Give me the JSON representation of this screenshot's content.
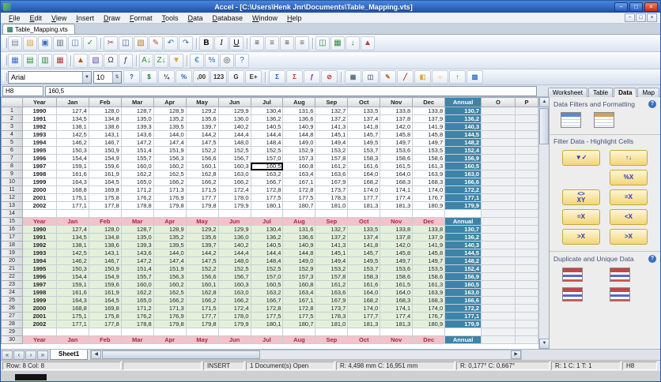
{
  "window": {
    "title": "Accel - [C:\\Users\\Henk Jnr\\Documents\\Table_Mapping.vts]",
    "doc_tab": "Table_Mapping.vts",
    "controls": [
      {
        "name": "minimize-button",
        "glyph": "−"
      },
      {
        "name": "maximize-button",
        "glyph": "□"
      },
      {
        "name": "close-button",
        "glyph": "×"
      }
    ]
  },
  "menu": {
    "items": [
      "File",
      "Edit",
      "View",
      "Insert",
      "Draw",
      "Format",
      "Tools",
      "Data",
      "Database",
      "Window",
      "Help"
    ],
    "window_controls": [
      {
        "name": "child-minimize-button",
        "glyph": "−"
      },
      {
        "name": "child-restore-button",
        "glyph": "□"
      },
      {
        "name": "child-close-button",
        "glyph": "×"
      }
    ]
  },
  "toolbar_main": {
    "icons": [
      {
        "name": "new-document",
        "glyph": "▤",
        "color": "#7a8aa0"
      },
      {
        "name": "open-folder",
        "glyph": "▨",
        "color": "#d9a62e"
      },
      {
        "name": "save",
        "glyph": "▣",
        "color": "#3a6fc0"
      },
      {
        "name": "print",
        "glyph": "▥",
        "color": "#5a6a7a"
      },
      {
        "name": "print-preview",
        "glyph": "◫",
        "color": "#4a7ab0"
      },
      {
        "name": "spellcheck",
        "glyph": "✓",
        "color": "#2e8b2e"
      },
      {
        "sep": true
      },
      {
        "name": "cut",
        "glyph": "✂",
        "color": "#9a3a3a"
      },
      {
        "name": "copy",
        "glyph": "◫",
        "color": "#3a5a9a"
      },
      {
        "name": "paste",
        "glyph": "▧",
        "color": "#b07a2a"
      },
      {
        "name": "format-painter",
        "glyph": "✎",
        "color": "#b0522a"
      },
      {
        "name": "undo",
        "glyph": "↶",
        "color": "#2a6ab0"
      },
      {
        "name": "redo",
        "glyph": "↷",
        "color": "#2a6ab0"
      },
      {
        "sep": true
      },
      {
        "name": "bold",
        "glyph": "B",
        "cls": "b"
      },
      {
        "name": "italic",
        "glyph": "I",
        "cls": "i"
      },
      {
        "name": "underline",
        "glyph": "U",
        "cls": "u"
      },
      {
        "sep": true
      },
      {
        "name": "align-left",
        "glyph": "≡",
        "color": "#333333"
      },
      {
        "name": "align-center",
        "glyph": "≡",
        "color": "#555555"
      },
      {
        "name": "align-right",
        "glyph": "≡",
        "color": "#333333"
      },
      {
        "name": "justify",
        "glyph": "≡",
        "color": "#555555"
      },
      {
        "sep": true
      },
      {
        "name": "merge-cells",
        "glyph": "◫",
        "color": "#2a7a4a"
      },
      {
        "name": "insert-sheet",
        "glyph": "▦",
        "color": "#2a8a3a"
      },
      {
        "name": "sort-ascending",
        "glyph": "↓",
        "color": "#2a8a3a"
      },
      {
        "name": "chart",
        "glyph": "▲",
        "color": "#c03a3a"
      }
    ]
  },
  "toolbar_secondary": {
    "icons": [
      {
        "name": "insert-table",
        "glyph": "▦",
        "color": "#3a6fc0"
      },
      {
        "name": "insert-row",
        "glyph": "▤",
        "color": "#2a8a3a"
      },
      {
        "name": "insert-column",
        "glyph": "▥",
        "color": "#2a8a3a"
      },
      {
        "name": "delete-cells",
        "glyph": "▦",
        "color": "#b03a3a"
      },
      {
        "sep": true
      },
      {
        "name": "insert-chart",
        "glyph": "▲",
        "color": "#b05a2a"
      },
      {
        "name": "insert-image",
        "glyph": "▧",
        "color": "#6a4ab0"
      },
      {
        "name": "insert-symbol",
        "glyph": "Ω",
        "color": "#3a3a3a"
      },
      {
        "name": "insert-function",
        "glyph": "ƒ",
        "color": "#3a3a3a"
      },
      {
        "sep": true
      },
      {
        "name": "sort-az",
        "glyph": "A↓",
        "color": "#2a8a3a"
      },
      {
        "name": "sort-za",
        "glyph": "Z↓",
        "color": "#2a8a3a"
      },
      {
        "name": "autofilter",
        "glyph": "▼",
        "color": "#d9a62e"
      },
      {
        "sep": true
      },
      {
        "name": "currency-euro",
        "glyph": "€",
        "color": "#2a6ab0"
      },
      {
        "name": "percent-style",
        "glyph": "%",
        "color": "#2a6ab0"
      },
      {
        "name": "zoom",
        "glyph": "◎",
        "color": "#3a3a3a"
      },
      {
        "name": "help",
        "glyph": "?",
        "color": "#2a6ab0"
      }
    ]
  },
  "formatbar": {
    "font_name": "Arial",
    "font_size": "10",
    "buttons": [
      {
        "name": "help-format",
        "glyph": "?",
        "color": "#1a5ac0"
      },
      {
        "name": "currency-format",
        "glyph": "$",
        "color": "#1a7a2a"
      },
      {
        "name": "fraction-format",
        "glyph": "¼",
        "color": "#333333"
      },
      {
        "name": "percent-format",
        "glyph": "%",
        "color": "#1a5ac0"
      },
      {
        "name": "add-decimal",
        "glyph": ",00",
        "color": "#333333"
      },
      {
        "name": "number-format",
        "glyph": "123",
        "color": "#333333"
      },
      {
        "name": "general-format",
        "glyph": "G",
        "color": "#333333"
      },
      {
        "name": "scientific-format",
        "glyph": "E+",
        "color": "#333333"
      },
      {
        "sep": true
      },
      {
        "name": "autosum",
        "glyph": "Σ",
        "color": "#1a5ac0"
      },
      {
        "name": "sum-result",
        "glyph": "Σ",
        "color": "#b03a2a"
      },
      {
        "name": "paste-function",
        "glyph": "ƒ",
        "color": "#7a2ab0"
      },
      {
        "name": "clear-formatting",
        "glyph": "⊘",
        "color": "#b03a2a"
      },
      {
        "sep": true
      },
      {
        "name": "borders",
        "glyph": "▦",
        "color": "#5a6a7a"
      },
      {
        "name": "merge-format",
        "glyph": "◫",
        "color": "#5a6a7a"
      },
      {
        "name": "draw-pencil",
        "glyph": "✎",
        "color": "#b0722a"
      },
      {
        "name": "draw-line",
        "glyph": "╱",
        "color": "#b03a2a"
      },
      {
        "name": "fill-color",
        "glyph": "◧",
        "color": "#d9a62e"
      },
      {
        "name": "draw-oval",
        "glyph": "○",
        "color": "#d9a62e"
      },
      {
        "name": "uppercase",
        "glyph": "↑",
        "color": "#1a7a2a"
      },
      {
        "name": "format-table",
        "glyph": "▥",
        "color": "#1a5ac0"
      }
    ]
  },
  "cellref": {
    "name": "H8",
    "value": "160,5"
  },
  "grid": {
    "rows_visible": 30,
    "columns": [
      "Year",
      "Jan",
      "Feb",
      "Mar",
      "Apr",
      "May",
      "Jun",
      "Jul",
      "Aug",
      "Sep",
      "Oct",
      "Nov",
      "Dec",
      "Annual",
      "O",
      "P"
    ],
    "repeat_header": [
      "Year",
      "Jan",
      "Feb",
      "Mar",
      "Apr",
      "May",
      "Jun",
      "Jul",
      "Aug",
      "Sep",
      "Oct",
      "Nov",
      "Dec",
      "Annual"
    ],
    "selected": {
      "ref": "H8",
      "row": 8,
      "col_index": 7,
      "value": "160,5"
    },
    "data": [
      [
        "1990",
        "127,4",
        "128,0",
        "128,7",
        "128,9",
        "129,2",
        "129,9",
        "130,4",
        "131,6",
        "132,7",
        "133,5",
        "133,8",
        "133,8",
        "130,7"
      ],
      [
        "1991",
        "134,5",
        "134,8",
        "135,0",
        "135,2",
        "135,6",
        "136,0",
        "136,2",
        "136,6",
        "137,2",
        "137,4",
        "137,8",
        "137,9",
        "136,2"
      ],
      [
        "1992",
        "138,1",
        "138,6",
        "139,3",
        "139,5",
        "139,7",
        "140,2",
        "140,5",
        "140,9",
        "141,3",
        "141,8",
        "142,0",
        "141,9",
        "140,3"
      ],
      [
        "1993",
        "142,5",
        "143,1",
        "143,6",
        "144,0",
        "144,2",
        "144,4",
        "144,4",
        "144,8",
        "145,1",
        "145,7",
        "145,8",
        "145,8",
        "144,5"
      ],
      [
        "1994",
        "146,2",
        "146,7",
        "147,2",
        "147,4",
        "147,5",
        "148,0",
        "148,4",
        "149,0",
        "149,4",
        "149,5",
        "149,7",
        "149,7",
        "148,2"
      ],
      [
        "1995",
        "150,3",
        "150,9",
        "151,4",
        "151,9",
        "152,2",
        "152,5",
        "152,5",
        "152,9",
        "153,2",
        "153,7",
        "153,6",
        "153,5",
        "152,4"
      ],
      [
        "1996",
        "154,4",
        "154,9",
        "155,7",
        "156,3",
        "156,6",
        "156,7",
        "157,0",
        "157,3",
        "157,8",
        "158,3",
        "158,6",
        "158,6",
        "156,9"
      ],
      [
        "1997",
        "159,1",
        "159,6",
        "160,0",
        "160,2",
        "160,1",
        "160,3",
        "160,5",
        "160,8",
        "161,2",
        "161,6",
        "161,5",
        "161,3",
        "160,5"
      ],
      [
        "1998",
        "161,6",
        "161,9",
        "162,2",
        "162,5",
        "162,8",
        "163,0",
        "163,2",
        "163,4",
        "163,6",
        "164,0",
        "164,0",
        "163,9",
        "163,0"
      ],
      [
        "1999",
        "164,3",
        "164,5",
        "165,0",
        "166,2",
        "166,2",
        "166,2",
        "166,7",
        "167,1",
        "167,9",
        "168,2",
        "168,3",
        "168,3",
        "166,6"
      ],
      [
        "2000",
        "168,8",
        "169,8",
        "171,2",
        "171,3",
        "171,5",
        "172,4",
        "172,8",
        "172,8",
        "173,7",
        "174,0",
        "174,1",
        "174,0",
        "172,2"
      ],
      [
        "2001",
        "175,1",
        "175,8",
        "176,2",
        "176,9",
        "177,7",
        "178,0",
        "177,5",
        "177,5",
        "178,3",
        "177,7",
        "177,4",
        "176,7",
        "177,1"
      ],
      [
        "2002",
        "177,1",
        "177,8",
        "178,8",
        "179,8",
        "179,8",
        "179,9",
        "180,1",
        "180,7",
        "181,0",
        "181,3",
        "181,3",
        "180,9",
        "179,9"
      ]
    ]
  },
  "scrollbars": {
    "v_up": "▲",
    "v_down": "▼",
    "h_left": "◀",
    "h_right": "▶"
  },
  "panel": {
    "help_glyph": "?",
    "tabs": [
      {
        "label": "Worksheet",
        "active": false
      },
      {
        "label": "Table",
        "active": false
      },
      {
        "label": "Data",
        "active": true
      },
      {
        "label": "Map",
        "active": false
      }
    ],
    "section1_title": "Data Filters and Formatting",
    "section2_title": "Filter Data - Highlight Cells",
    "section3_title": "Duplicate and Unique Data",
    "formatting_icons": [
      {
        "name": "conditional-format",
        "variant": "cf1"
      },
      {
        "name": "table-autoformat",
        "variant": "cf2"
      }
    ],
    "filter_icons": [
      {
        "name": "filter-values",
        "glyph": "▼✓"
      },
      {
        "name": "flip-values",
        "glyph": "↑↓"
      },
      {
        "name": "",
        "glyph": ""
      },
      {
        "name": "percent-of-x",
        "glyph": "%X"
      },
      {
        "name": "between-xy",
        "glyph": "<>\nXY"
      },
      {
        "name": "equal-to-x",
        "glyph": "=X"
      },
      {
        "name": "highlight-equal-x",
        "glyph": "=X"
      },
      {
        "name": "less-than-x",
        "glyph": "<X"
      },
      {
        "name": "greater-than-x",
        "glyph": ">X"
      },
      {
        "name": "greater-equal-x",
        "glyph": ">X"
      }
    ],
    "duplicate_icons": [
      {
        "name": "highlight-duplicates"
      },
      {
        "name": "remove-duplicates"
      },
      {
        "name": "highlight-unique"
      },
      {
        "name": "copy-unique"
      }
    ]
  },
  "sheetbar": {
    "tab": "Sheet1",
    "nav": [
      {
        "name": "first-sheet",
        "glyph": "«"
      },
      {
        "name": "prev-sheet",
        "glyph": "‹"
      },
      {
        "name": "next-sheet",
        "glyph": "›"
      },
      {
        "name": "last-sheet",
        "glyph": "»"
      }
    ]
  },
  "statusbar": {
    "segments": [
      {
        "name": "cell-position",
        "text": "Row: 8  Col: 8"
      },
      {
        "name": "mode",
        "text": "INSERT"
      },
      {
        "name": "documents-open",
        "text": "1 Document(s) Open"
      },
      {
        "name": "cursor-mm",
        "text": "R: 4,498 mm  C: 16,951 mm"
      },
      {
        "name": "cursor-angle",
        "text": "R: 0,177°  C: 0,667°"
      },
      {
        "name": "counts",
        "text": "R: 1  C: 1  T: 1"
      },
      {
        "name": "active-cell",
        "text": "H8"
      }
    ]
  }
}
